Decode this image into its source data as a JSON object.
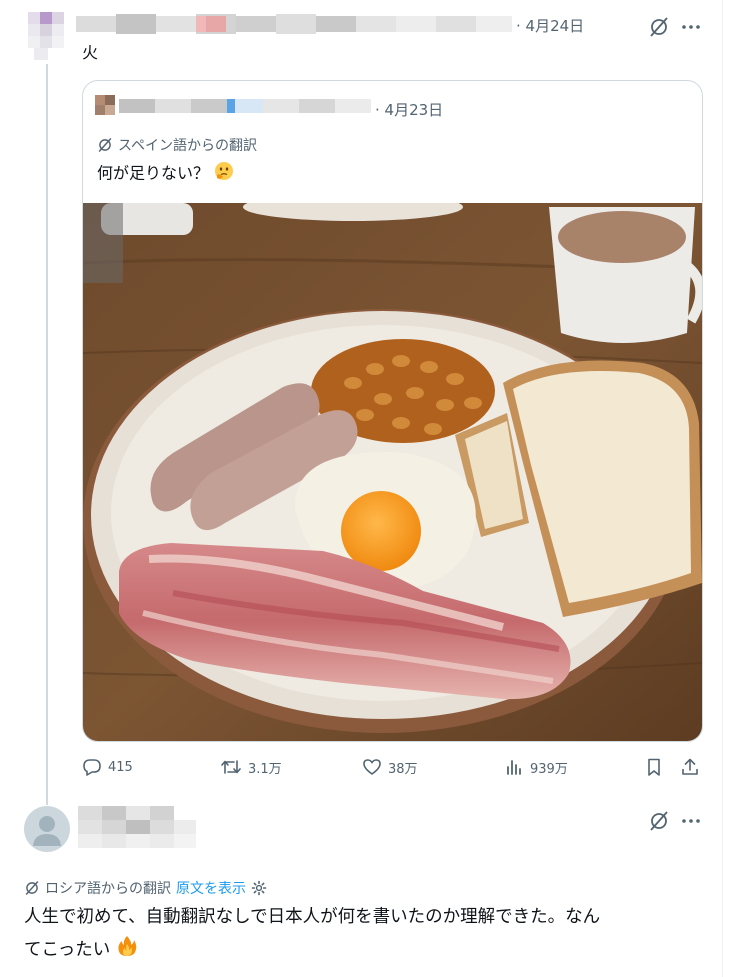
{
  "colors": {
    "accent": "#1d9bf0",
    "secondary_text": "#536471",
    "border": "#cfd9de"
  },
  "tweet1": {
    "date": "· 4月24日",
    "text": "火"
  },
  "quoted": {
    "date": "· 4月23日",
    "translate_note": "スペイン語からの翻訳",
    "text": "何が足りない？",
    "text_emoji": "thinking-face-emoji"
  },
  "actions": {
    "replies": "415",
    "retweets": "3.1万",
    "likes": "38万",
    "views": "939万"
  },
  "reply": {
    "translate_note": "ロシア語からの翻訳",
    "show_original": "原文を表示",
    "text_line1": "人生で初めて、自動翻訳なしで日本人が何を書いたのか理解できた。なん",
    "text_line2": "てこったい",
    "text_emoji": "fire-emoji"
  },
  "icons": {
    "grok": "grok-slash-icon",
    "more": "more-dots-icon",
    "reply": "reply-bubble-icon",
    "retweet": "retweet-icon",
    "like": "heart-icon",
    "views": "views-bars-icon",
    "bookmark": "bookmark-icon",
    "share": "share-icon",
    "settings": "gear-icon"
  }
}
